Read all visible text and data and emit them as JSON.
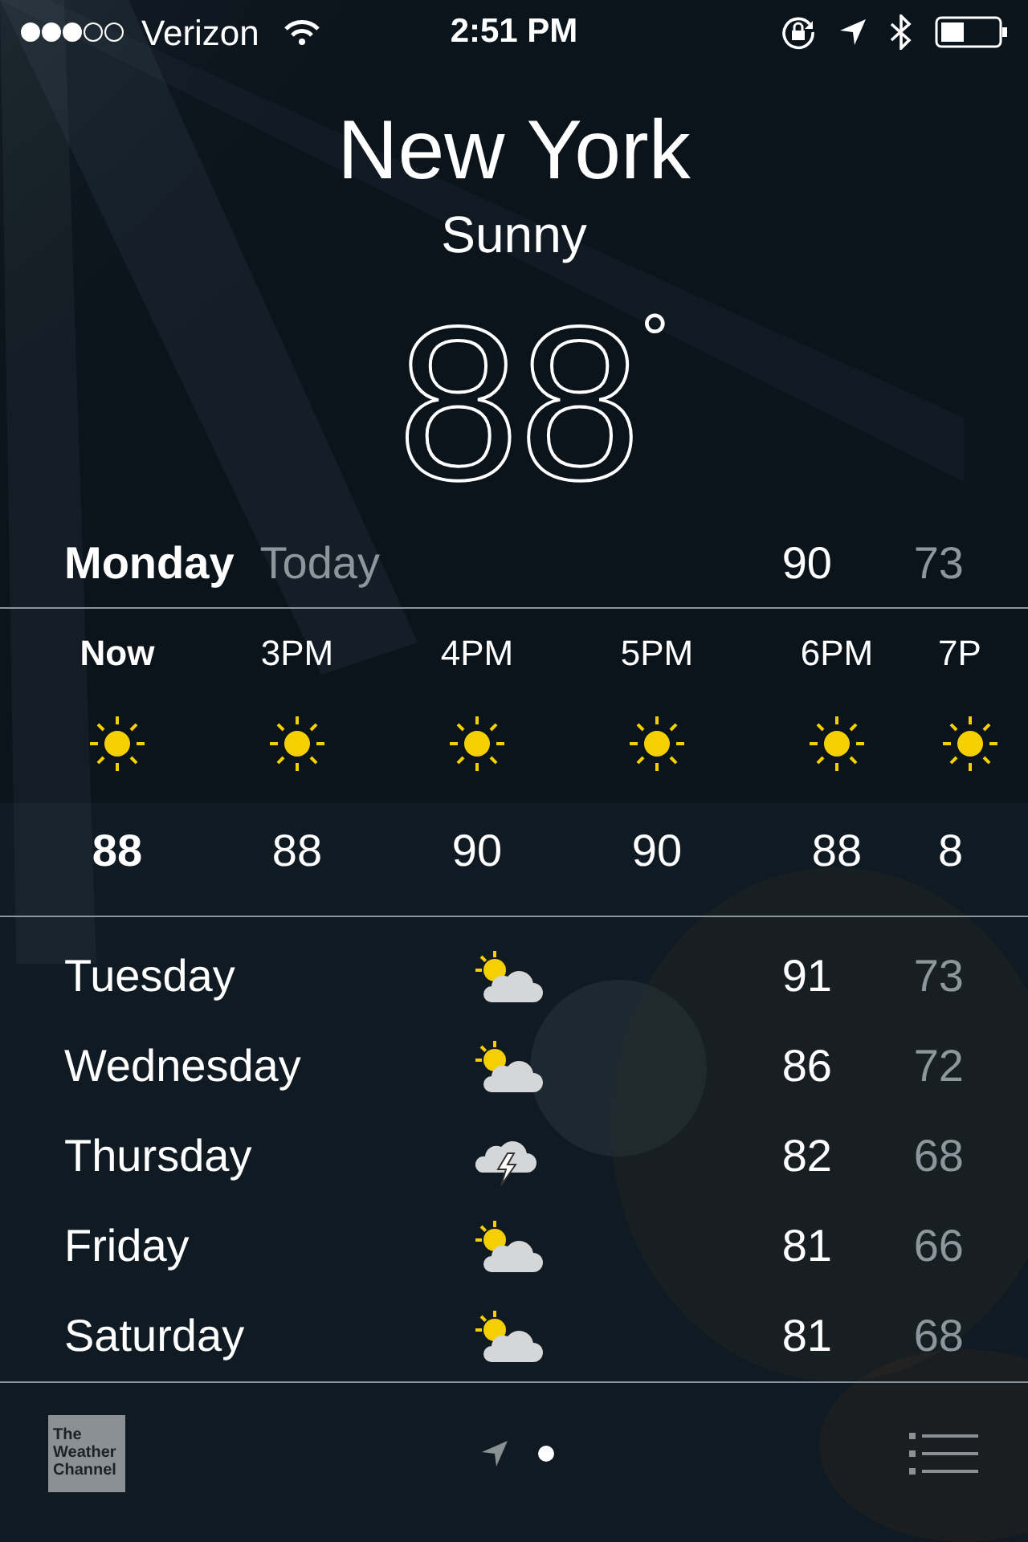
{
  "status_bar": {
    "carrier": "Verizon",
    "time": "2:51 PM"
  },
  "city": "New York",
  "condition": "Sunny",
  "temperature": "88",
  "degree": "°",
  "today": {
    "day": "Monday",
    "label": "Today",
    "high": "90",
    "low": "73"
  },
  "hourly": [
    {
      "time": "Now",
      "current": true,
      "kind": "sun",
      "temp": "88"
    },
    {
      "time": "3PM",
      "current": false,
      "kind": "sun",
      "temp": "88"
    },
    {
      "time": "4PM",
      "current": false,
      "kind": "sun",
      "temp": "90"
    },
    {
      "time": "5PM",
      "current": false,
      "kind": "sun",
      "temp": "90"
    },
    {
      "time": "6PM",
      "current": false,
      "kind": "sun",
      "temp": "88"
    },
    {
      "time": "7P",
      "current": false,
      "kind": "sun",
      "temp": "8"
    }
  ],
  "daily": [
    {
      "day": "Tuesday",
      "kind": "partly-sunny",
      "high": "91",
      "low": "73"
    },
    {
      "day": "Wednesday",
      "kind": "partly-sunny",
      "high": "86",
      "low": "72"
    },
    {
      "day": "Thursday",
      "kind": "thunderstorm",
      "high": "82",
      "low": "68"
    },
    {
      "day": "Friday",
      "kind": "partly-sunny",
      "high": "81",
      "low": "66"
    },
    {
      "day": "Saturday",
      "kind": "partly-sunny",
      "high": "81",
      "low": "68"
    }
  ],
  "footer": {
    "logo": [
      "The",
      "Weather",
      "Channel"
    ],
    "pages": [
      {
        "kind": "location",
        "selected": false
      },
      {
        "kind": "dot",
        "selected": true
      }
    ]
  }
}
